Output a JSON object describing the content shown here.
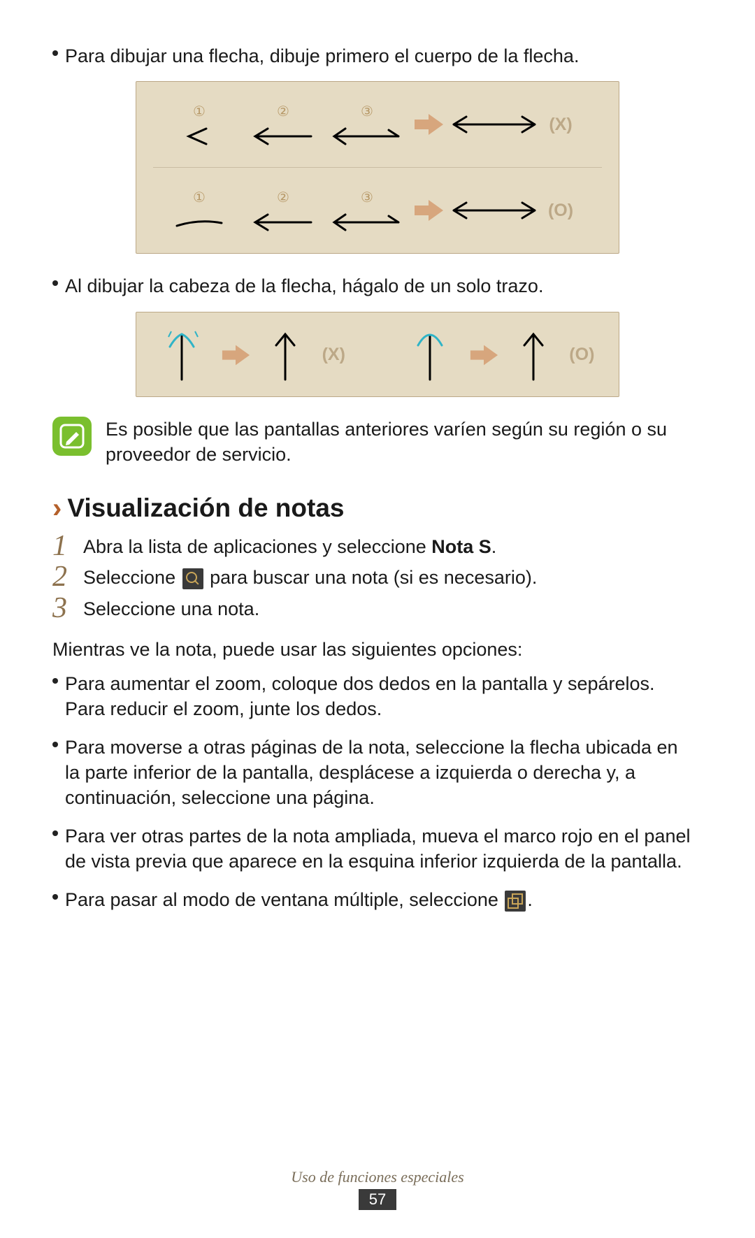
{
  "bullets": {
    "arrow_body": "Para dibujar una flecha, dibuje primero el cuerpo de la flecha.",
    "arrow_head": "Al dibujar la cabeza de la flecha, hágalo de un solo trazo."
  },
  "illus": {
    "step1": "①",
    "step2": "②",
    "step3": "③",
    "verdict_wrong": "(X)",
    "verdict_right": "(O)"
  },
  "note": "Es posible que las pantallas anteriores varíen según su región o su proveedor de servicio.",
  "section": {
    "title": "Visualización de notas"
  },
  "steps": {
    "s1_a": "Abra la lista de aplicaciones y seleccione ",
    "s1_b": "Nota S",
    "s1_c": ".",
    "s2_a": "Seleccione ",
    "s2_b": " para buscar una nota (si es necesario).",
    "s3": "Seleccione una nota."
  },
  "options_intro": "Mientras ve la nota, puede usar las siguientes opciones:",
  "options": {
    "o1": "Para aumentar el zoom, coloque dos dedos en la pantalla y sepárelos. Para reducir el zoom, junte los dedos.",
    "o2": "Para moverse a otras páginas de la nota, seleccione la flecha ubicada en la parte inferior de la pantalla, desplácese a izquierda o derecha y, a continuación, seleccione una página.",
    "o3": "Para ver otras partes de la nota ampliada, mueva el marco rojo en el panel de vista previa que aparece en la esquina inferior izquierda de la pantalla.",
    "o4_a": "Para pasar al modo de ventana múltiple, seleccione ",
    "o4_b": "."
  },
  "footer": {
    "section": "Uso de funciones especiales",
    "page": "57"
  }
}
